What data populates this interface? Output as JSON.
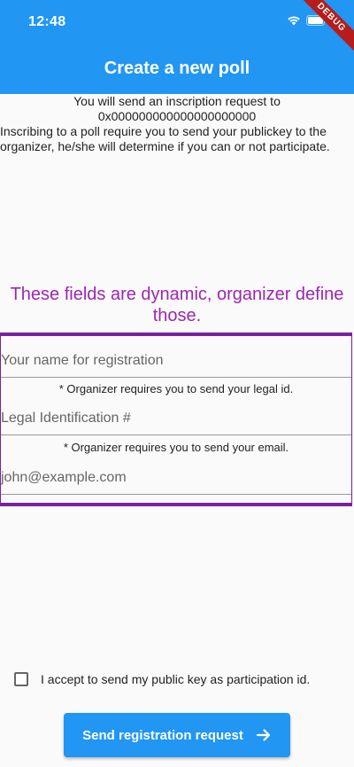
{
  "status_bar": {
    "time": "12:48",
    "debug_label": "DEBUG"
  },
  "appbar": {
    "title": "Create a new poll"
  },
  "intro": {
    "line1": "You will send an inscription request to",
    "address": "0x000000000000000000000",
    "description": "Inscribing to a poll require you to send your publickey to the organizer, he/she will determine if you can or not participate."
  },
  "dynamic_note": "These fields are dynamic, organizer define those.",
  "fields": [
    {
      "placeholder": "Your name for registration",
      "value": ""
    },
    {
      "note": "* Organizer requires you to send your legal id.",
      "placeholder": "Legal Identification #",
      "value": ""
    },
    {
      "note": "* Organizer requires you to send your email.",
      "placeholder": "john@example.com",
      "value": ""
    }
  ],
  "consent": {
    "label": "I accept to send my public key as participation id.",
    "checked": false
  },
  "send_button": {
    "label": "Send registration request"
  },
  "colors": {
    "primary": "#2196f3",
    "accent_purple": "#9c27b0",
    "border_purple": "#7b1fa2"
  }
}
